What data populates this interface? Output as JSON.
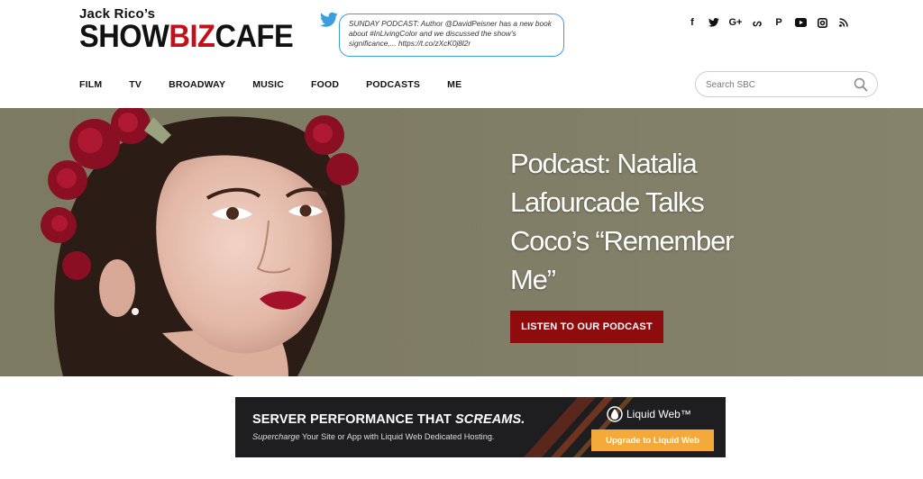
{
  "logo": {
    "top": "Jack Rico’s",
    "show": "SHOW",
    "biz": "BIZ",
    "cafe": "CAFE"
  },
  "tweet": {
    "text": "SUNDAY PODCAST: Author @DavidPeisner has a new book about #InLivingColor and we discussed the show's significance,... https://t.co/zXcK0j8l2r"
  },
  "social": [
    {
      "name": "facebook-icon",
      "glyph": "f"
    },
    {
      "name": "twitter-icon",
      "glyph": "🐦"
    },
    {
      "name": "google-plus-icon",
      "glyph": "G+"
    },
    {
      "name": "stumbleupon-icon",
      "glyph": "ᔕ"
    },
    {
      "name": "pinterest-icon",
      "glyph": "P"
    },
    {
      "name": "youtube-icon",
      "glyph": "▶"
    },
    {
      "name": "instagram-icon",
      "glyph": "◎"
    },
    {
      "name": "rss-icon",
      "glyph": "◔"
    }
  ],
  "nav": [
    "FILM",
    "TV",
    "BROADWAY",
    "MUSIC",
    "FOOD",
    "PODCASTS",
    "ME"
  ],
  "search": {
    "placeholder": "Search SBC"
  },
  "hero": {
    "title": "Podcast: Natalia Lafourcade Talks Coco’s “Remember Me”",
    "button": "LISTEN TO OUR PODCAST"
  },
  "ad": {
    "headline_a": "SERVER PERFORMANCE THAT ",
    "headline_b": "SCREAMS.",
    "sub_a": "Supercharge",
    "sub_b": " Your Site or App with Liquid Web Dedicated Hosting.",
    "brand": "Liquid Web™",
    "button": "Upgrade to Liquid Web"
  },
  "colors": {
    "brand_red": "#c0121d",
    "button_red": "#8e0b0e",
    "hero_bg": "#7f7c65",
    "twitter_blue": "#3a9de0",
    "ad_orange": "#f6a93b"
  }
}
